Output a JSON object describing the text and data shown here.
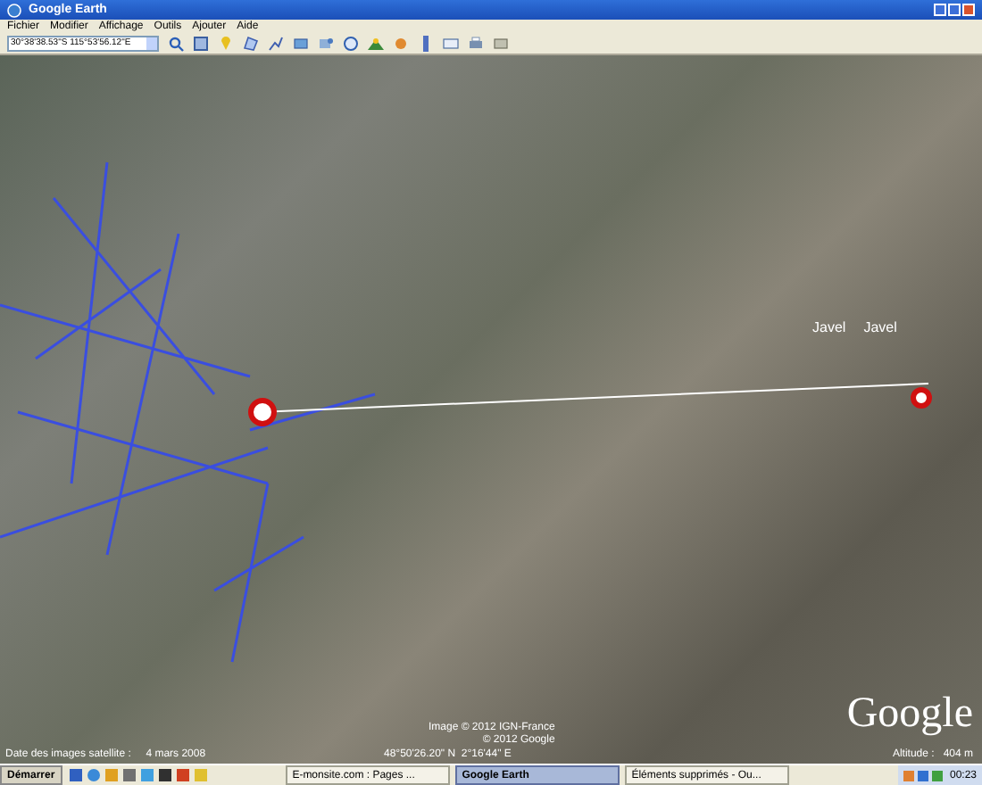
{
  "window": {
    "title": "Google Earth"
  },
  "menu": [
    "Fichier",
    "Modifier",
    "Affichage",
    "Outils",
    "Ajouter",
    "Aide"
  ],
  "search": {
    "value": "30°38'38.53\"S 115°53'56.12\"E"
  },
  "map": {
    "labels": [
      "Javel",
      "Javel"
    ],
    "imagery_date": "Date des images satellite :     4 mars 2008",
    "credits": [
      "Image © 2012 IGN-France",
      "© 2012 Google"
    ],
    "coordinates": "48°50'26.20\" N  2°16'44\" E",
    "altitude": "Altitude :   404 m",
    "logo": "Google"
  },
  "taskbar": {
    "start": "Démarrer",
    "tasks": [
      {
        "label": "E-monsite.com : Pages ...",
        "selected": false
      },
      {
        "label": "Google Earth",
        "selected": true
      },
      {
        "label": "Éléments supprimés - Ou...",
        "selected": false
      }
    ],
    "clock": "00:23"
  }
}
